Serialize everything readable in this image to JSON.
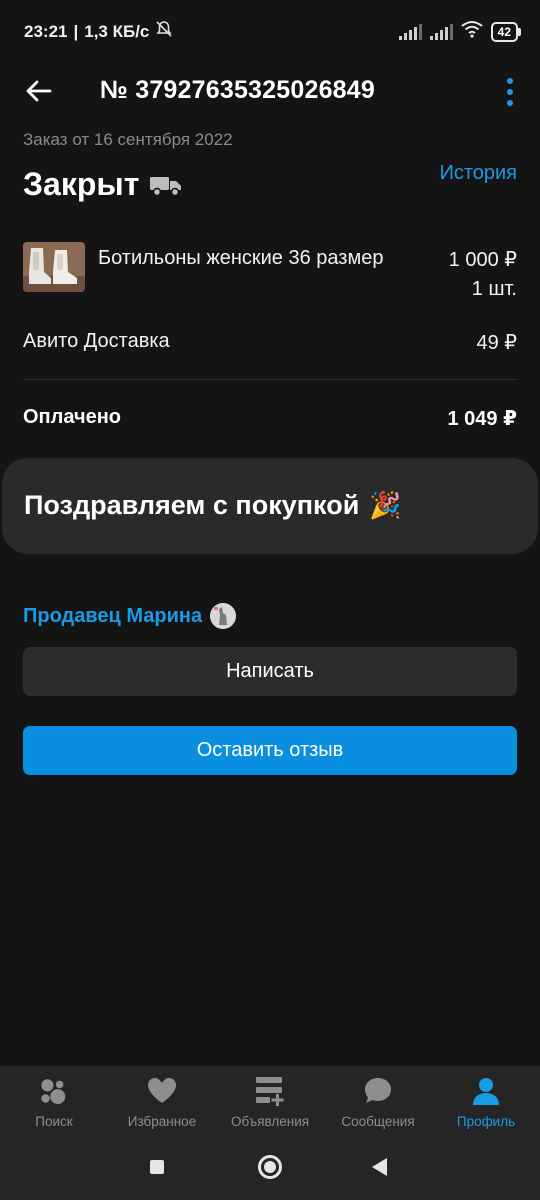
{
  "status_bar": {
    "time": "23:21",
    "network_speed": "1,3 КБ/с",
    "battery": "42"
  },
  "header": {
    "order_number": "№ 37927635325026849"
  },
  "order": {
    "date_text": "Заказ от 16 сентября 2022",
    "status": "Закрыт",
    "history_link": "История",
    "item": {
      "name": "Ботильоны женские 36 размер",
      "price": "1 000 ₽",
      "quantity": "1 шт."
    },
    "delivery": {
      "label": "Авито Доставка",
      "price": "49 ₽"
    },
    "paid": {
      "label": "Оплачено",
      "total": "1 049 ₽"
    }
  },
  "congrats": {
    "text": "Поздравляем с покупкой",
    "emoji": "🎉"
  },
  "seller": {
    "link": "Продавец Марина",
    "write_button": "Написать",
    "review_button": "Оставить отзыв"
  },
  "bottom_nav": {
    "items": [
      {
        "label": "Поиск",
        "icon": "search-icon"
      },
      {
        "label": "Избранное",
        "icon": "heart-icon"
      },
      {
        "label": "Объявления",
        "icon": "listings-add-icon"
      },
      {
        "label": "Сообщения",
        "icon": "chat-icon"
      },
      {
        "label": "Профиль",
        "icon": "profile-icon",
        "active": true
      }
    ]
  },
  "colors": {
    "accent": "#1a9be6",
    "background": "#141414",
    "card": "#2a2a2a",
    "primary_button": "#0a8fe0"
  }
}
